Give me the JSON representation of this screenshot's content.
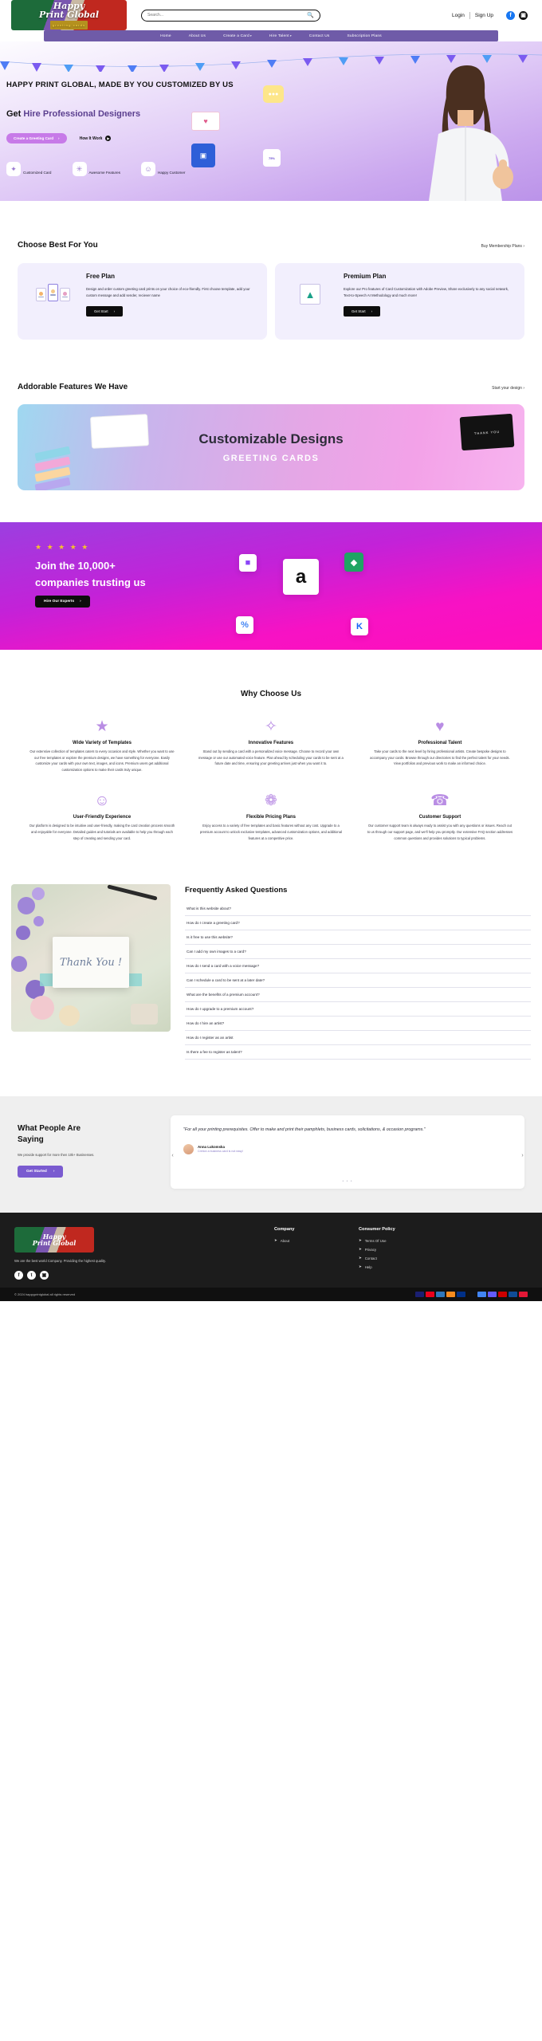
{
  "header": {
    "logo": {
      "line1": "Happy",
      "line2": "Print Global",
      "sub": "greeting cards"
    },
    "search": {
      "placeholder": "Search...",
      "value": "",
      "icon": "search-icon"
    },
    "login": "Login",
    "signup": "Sign Up",
    "social": [
      {
        "name": "facebook-icon",
        "glyph": "f"
      },
      {
        "name": "instagram-icon",
        "glyph": "▣"
      }
    ]
  },
  "nav": {
    "items": [
      {
        "label": "Home",
        "caret": ""
      },
      {
        "label": "About Us",
        "caret": ""
      },
      {
        "label": "Create a Card",
        "caret": "▾"
      },
      {
        "label": "Hire Talent",
        "caret": "▾"
      },
      {
        "label": "Contact Us",
        "caret": ""
      },
      {
        "label": "Subscription Plans",
        "caret": ""
      }
    ]
  },
  "hero": {
    "headline": "HAPPY PRINT GLOBAL, MADE BY YOU CUSTOMIZED BY US",
    "sub_prefix": "Get ",
    "sub_accent": "Hire Professional Designers",
    "cta_primary": "Create a Greeting Card",
    "cta_primary_arrow": "›",
    "cta_secondary": "How It Work",
    "cta_secondary_icon": "play-circle-icon",
    "features": [
      {
        "label": "Customized Card",
        "icon": "magic-wand-icon",
        "glyph": "✦"
      },
      {
        "label": "Awesome Features",
        "icon": "sparkle-burst-icon",
        "glyph": "✳"
      },
      {
        "label": "Happy Customer",
        "icon": "smiley-face-icon",
        "glyph": "☺"
      }
    ],
    "floating": {
      "chat_bubble": "chat-bubble-icon",
      "envelope_heart": "envelope-heart-icon",
      "phone_card": "phone-card-icon",
      "badge": "discount-badge-icon"
    }
  },
  "plans_section": {
    "title": "Choose Best For You",
    "link": "Buy Membership Plans",
    "link_arrow": "›",
    "plans": [
      {
        "title": "Free Plan",
        "desc": "Design and order custom greeting card prints on your choice of eco-friendly. First choose template, add your custom message and add sender, reciever name",
        "button": "Get Start",
        "button_arrow": "›",
        "art": "three-cards-icon"
      },
      {
        "title": "Premium Plan",
        "desc": "Explore our Pro features of Card Customization with Adobe Preview, Share exclusively to any social network, Text-to-Speech AI Methodology and much more!",
        "button": "Get Start",
        "button_arrow": "›",
        "art": "image-placeholder-icon"
      }
    ]
  },
  "features_section": {
    "title": "Addorable Features We Have",
    "link": "Start your design",
    "link_arrow": "›",
    "banner": {
      "title": "Customizable Designs",
      "subtitle": "GREETING CARDS",
      "dark_card_text": "THANK YOU"
    }
  },
  "trust_section": {
    "stars": "★ ★ ★ ★ ★",
    "heading_line1": "Join the 10,000+",
    "heading_line2": "companies trusting us",
    "button": "Hire Our Experts",
    "button_arrow": "›",
    "brands": [
      {
        "name": "brand-tile-twitch",
        "glyph": "■",
        "color": "#8b45f7"
      },
      {
        "name": "brand-tile-amazon",
        "glyph": "a",
        "color": "#111111"
      },
      {
        "name": "brand-tile-zillow",
        "glyph": "◆",
        "color": "#1fa463"
      },
      {
        "name": "brand-tile-google",
        "glyph": "%",
        "color": "#4285f4"
      },
      {
        "name": "brand-tile-kickstarter",
        "glyph": "K",
        "color": "#1464f6"
      }
    ]
  },
  "why_section": {
    "title": "Why Choose Us",
    "cards": [
      {
        "icon": "award-ribbon-icon",
        "glyph": "★",
        "title": "Wide Variety of Templates",
        "text": "Our extensive collection of templates caters to every occasion and style. Whether you want to use our free templates or explore the premium designs, we have something for everyone. Easily customize your cards with your own text, images, and icons. Premium users get additional customization options to make their cards truly unique."
      },
      {
        "icon": "lightbulb-box-icon",
        "glyph": "✧",
        "title": "Innovative Features",
        "text": "Stand out by sending a card with a personalized voice message. Choose to record your own message or use our automated voice feature. Plan ahead by scheduling your cards to be sent at a future date and time, ensuring your greeting arrives just when you want it to."
      },
      {
        "icon": "heart-icon",
        "glyph": "♥",
        "title": "Professional Talent",
        "text": "Take your cards to the next level by hiring professional artists. Create bespoke designs to accompany your cards. Browse through our directories to find the perfect talent for your needs. View portfolios and previous work to make an informed choice."
      },
      {
        "icon": "smiley-circle-icon",
        "glyph": "☺",
        "title": "User-Friendly Experience",
        "text": "Our platform is designed to be intuitive and user-friendly, making the card creation process smooth and enjoyable for everyone. Detailed guides and tutorials are available to help you through each step of creating and sending your card."
      },
      {
        "icon": "price-tag-icon",
        "glyph": "❁",
        "title": "Flexible Pricing Plans",
        "text": "Enjoy access to a variety of free templates and basic features without any cost. Upgrade to a premium account to unlock exclusive templates, advanced customization options, and additional features at a competitive price."
      },
      {
        "icon": "support-headset-icon",
        "glyph": "☎",
        "title": "Customer Support",
        "text": "Our customer support team is always ready to assist you with any questions or issues. Reach out to us through our support page, and we'll help you promptly. Our extensive FAQ section addresses common questions and provides solutions to typical problems."
      }
    ]
  },
  "faq_section": {
    "title": "Frequently Asked Questions",
    "image_card_text": "Thank You !",
    "questions": [
      "What is this website about?",
      "How do I create a greeting card?",
      "Is it free to use this website?",
      "Can I add my own images to a card?",
      "How do I send a card with a voice message?",
      "Can I schedule a card to be sent at a later date?",
      "What are the benefits of a premium account?",
      "How do I upgrade to a premium account?",
      "How do I hire an artist?",
      "How do I register as an artist",
      "Is there a fee to register as talent?"
    ]
  },
  "testimonial_section": {
    "heading_line1": "What People Are",
    "heading_line2": "Saying",
    "subtext": "We provide support for more then 10k+ Businesses.",
    "button": "Get Started",
    "button_arrow": "›",
    "quote": "\"For all your printing prerequisites. Offer to make and print their pamphlets, business cards, solicitations, & occasion programs.\"",
    "author_name": "Anna Lukomska",
    "author_role": "Cretion a business card is not easy!",
    "prev_arrow": "‹",
    "next_arrow": "›",
    "dots": "• • •"
  },
  "footer": {
    "logo": {
      "line1": "Happy",
      "line2": "Print Global"
    },
    "desc": "We are the best world Company. Providing the highest quality.",
    "social": [
      {
        "name": "facebook-icon",
        "glyph": "f"
      },
      {
        "name": "twitter-icon",
        "glyph": "t"
      },
      {
        "name": "instagram-icon",
        "glyph": "▣"
      }
    ],
    "columns": [
      {
        "heading": "Company",
        "links": [
          "About"
        ]
      },
      {
        "heading": "Consumer Policy",
        "links": [
          "Terms Of Use",
          "Privacy",
          "Contact",
          "Help"
        ]
      }
    ],
    "copyright": "© 2024  happyprintglobal all rights reserved",
    "payment_icons": [
      "visa",
      "mastercard",
      "amex",
      "discover",
      "paypal",
      "applepay",
      "gpay",
      "stripe",
      "maestro",
      "jcb",
      "unionpay"
    ]
  }
}
